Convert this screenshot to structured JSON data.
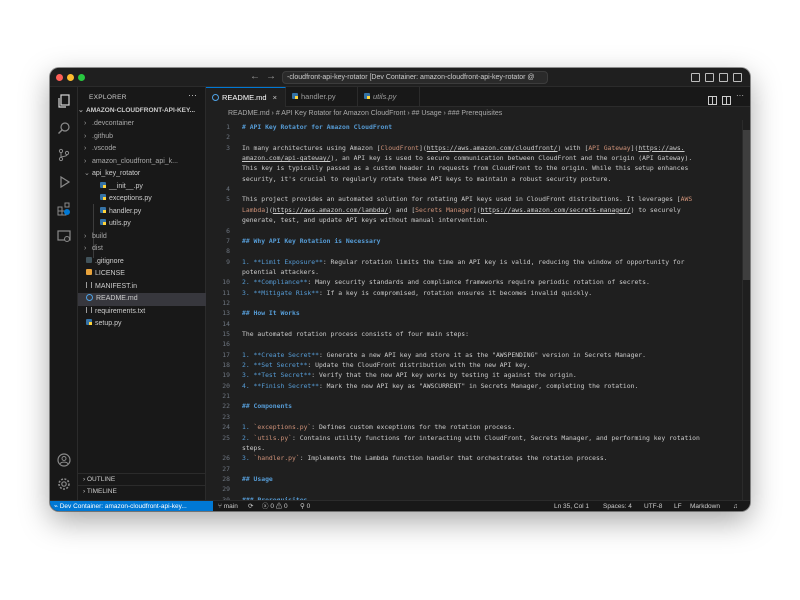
{
  "titlebar": {
    "title": "-cloudfront-api-key-rotator [Dev Container: amazon-cloudfront-api-key-rotator @"
  },
  "sidebar": {
    "header": "EXPLORER",
    "more": "···",
    "root": "AMAZON-CLOUDFRONT-API-KEY...",
    "items": [
      {
        "label": ".devcontainer",
        "kind": "folder"
      },
      {
        "label": ".github",
        "kind": "folder"
      },
      {
        "label": ".vscode",
        "kind": "folder"
      },
      {
        "label": "amazon_cloudfront_api_k...",
        "kind": "folder"
      },
      {
        "label": "api_key_rotator",
        "kind": "folder-open"
      },
      {
        "label": "__init__.py",
        "kind": "python"
      },
      {
        "label": "exceptions.py",
        "kind": "python"
      },
      {
        "label": "handler.py",
        "kind": "python"
      },
      {
        "label": "utils.py",
        "kind": "python"
      },
      {
        "label": "build",
        "kind": "folder"
      },
      {
        "label": "dist",
        "kind": "folder"
      },
      {
        "label": ".gitignore",
        "kind": "git"
      },
      {
        "label": "LICENSE",
        "kind": "license"
      },
      {
        "label": "MANIFEST.in",
        "kind": "generic"
      },
      {
        "label": "README.md",
        "kind": "info"
      },
      {
        "label": "requirements.txt",
        "kind": "generic"
      },
      {
        "label": "setup.py",
        "kind": "python"
      }
    ],
    "outline": "OUTLINE",
    "timeline": "TIMELINE"
  },
  "tabs": [
    {
      "label": "README.md",
      "close": "×"
    },
    {
      "label": "handler.py"
    },
    {
      "label": "utils.py"
    }
  ],
  "breadcrumb": "README.md  ›  # API Key Rotator for Amazon CloudFront  ›  ## Usage  ›  ### Prerequisites",
  "editor": {
    "lines": [
      {
        "n": "1",
        "segs": [
          {
            "t": "# API Key Rotator for Amazon CloudFront",
            "c": "hdr"
          }
        ]
      },
      {
        "n": "2",
        "segs": []
      },
      {
        "n": "3",
        "segs": [
          {
            "t": "In many architectures using Amazon ["
          },
          {
            "t": "CloudFront",
            "c": "lnk"
          },
          {
            "t": "]("
          },
          {
            "t": "https://aws.amazon.com/cloudfront/",
            "c": "url"
          },
          {
            "t": ") with ["
          },
          {
            "t": "API Gateway",
            "c": "lnk"
          },
          {
            "t": "]("
          },
          {
            "t": "https://aws.",
            "c": "url"
          }
        ]
      },
      {
        "n": "",
        "segs": [
          {
            "t": "amazon.com/api-gateway/",
            "c": "url"
          },
          {
            "t": "), an API key is used to secure communication between CloudFront and the origin (API Gateway)."
          }
        ]
      },
      {
        "n": "",
        "segs": [
          {
            "t": "This key is typically passed as a custom header in requests from CloudFront to the origin. While this setup enhances"
          }
        ]
      },
      {
        "n": "",
        "segs": [
          {
            "t": "security, it's crucial to regularly rotate these API keys to maintain a robust security posture."
          }
        ]
      },
      {
        "n": "4",
        "segs": []
      },
      {
        "n": "5",
        "segs": [
          {
            "t": "This project provides an automated solution for rotating API keys used in CloudFront distributions. It leverages ["
          },
          {
            "t": "AWS",
            "c": "lnk"
          }
        ]
      },
      {
        "n": "",
        "segs": [
          {
            "t": "Lambda",
            "c": "lnk"
          },
          {
            "t": "]("
          },
          {
            "t": "https://aws.amazon.com/lambda/",
            "c": "url"
          },
          {
            "t": ") and ["
          },
          {
            "t": "Secrets Manager",
            "c": "lnk"
          },
          {
            "t": "]("
          },
          {
            "t": "https://aws.amazon.com/secrets-manager/",
            "c": "url"
          },
          {
            "t": ") to securely"
          }
        ]
      },
      {
        "n": "",
        "segs": [
          {
            "t": "generate, test, and update API keys without manual intervention."
          }
        ]
      },
      {
        "n": "6",
        "segs": []
      },
      {
        "n": "7",
        "segs": [
          {
            "t": "## Why API Key Rotation is Necessary",
            "c": "hdr"
          }
        ]
      },
      {
        "n": "8",
        "segs": []
      },
      {
        "n": "9",
        "segs": [
          {
            "t": "1. ",
            "c": "bold"
          },
          {
            "t": "**Limit Exposure**",
            "c": "bold"
          },
          {
            "t": ": Regular rotation limits the time an API key is valid, reducing the window of opportunity for"
          }
        ]
      },
      {
        "n": "",
        "segs": [
          {
            "t": "potential attackers."
          }
        ]
      },
      {
        "n": "10",
        "segs": [
          {
            "t": "2. ",
            "c": "bold"
          },
          {
            "t": "**Compliance**",
            "c": "bold"
          },
          {
            "t": ": Many security standards and compliance frameworks require periodic rotation of secrets."
          }
        ]
      },
      {
        "n": "11",
        "segs": [
          {
            "t": "3. ",
            "c": "bold"
          },
          {
            "t": "**Mitigate Risk**",
            "c": "bold"
          },
          {
            "t": ": If a key is compromised, rotation ensures it becomes invalid quickly."
          }
        ]
      },
      {
        "n": "12",
        "segs": []
      },
      {
        "n": "13",
        "segs": [
          {
            "t": "## How It Works",
            "c": "hdr"
          }
        ]
      },
      {
        "n": "14",
        "segs": []
      },
      {
        "n": "15",
        "segs": [
          {
            "t": "The automated rotation process consists of four main steps:"
          }
        ]
      },
      {
        "n": "16",
        "segs": []
      },
      {
        "n": "17",
        "segs": [
          {
            "t": "1. ",
            "c": "bold"
          },
          {
            "t": "**Create Secret**",
            "c": "bold"
          },
          {
            "t": ": Generate a new API key and store it as the \"AWSPENDING\" version in Secrets Manager."
          }
        ]
      },
      {
        "n": "18",
        "segs": [
          {
            "t": "2. ",
            "c": "bold"
          },
          {
            "t": "**Set Secret**",
            "c": "bold"
          },
          {
            "t": ": Update the CloudFront distribution with the new API key."
          }
        ]
      },
      {
        "n": "19",
        "segs": [
          {
            "t": "3. ",
            "c": "bold"
          },
          {
            "t": "**Test Secret**",
            "c": "bold"
          },
          {
            "t": ": Verify that the new API key works by testing it against the origin."
          }
        ]
      },
      {
        "n": "20",
        "segs": [
          {
            "t": "4. ",
            "c": "bold"
          },
          {
            "t": "**Finish Secret**",
            "c": "bold"
          },
          {
            "t": ": Mark the new API key as \"AWSCURRENT\" in Secrets Manager, completing the rotation."
          }
        ]
      },
      {
        "n": "21",
        "segs": []
      },
      {
        "n": "22",
        "segs": [
          {
            "t": "## Components",
            "c": "hdr"
          }
        ]
      },
      {
        "n": "23",
        "segs": []
      },
      {
        "n": "24",
        "segs": [
          {
            "t": "1. ",
            "c": "bold"
          },
          {
            "t": "`exceptions.py`",
            "c": "code"
          },
          {
            "t": ": Defines custom exceptions for the rotation process."
          }
        ]
      },
      {
        "n": "25",
        "segs": [
          {
            "t": "2. ",
            "c": "bold"
          },
          {
            "t": "`utils.py`",
            "c": "code"
          },
          {
            "t": ": Contains utility functions for interacting with CloudFront, Secrets Manager, and performing key rotation"
          }
        ]
      },
      {
        "n": "",
        "segs": [
          {
            "t": "steps."
          }
        ]
      },
      {
        "n": "26",
        "segs": [
          {
            "t": "3. ",
            "c": "bold"
          },
          {
            "t": "`handler.py`",
            "c": "code"
          },
          {
            "t": ": Implements the Lambda function handler that orchestrates the rotation process."
          }
        ]
      },
      {
        "n": "27",
        "segs": []
      },
      {
        "n": "28",
        "segs": [
          {
            "t": "## Usage",
            "c": "hdr"
          }
        ]
      },
      {
        "n": "29",
        "segs": []
      },
      {
        "n": "30",
        "segs": [
          {
            "t": "### Prerequisites",
            "c": "hdr"
          }
        ]
      }
    ]
  },
  "statusbar": {
    "remote": "Dev Container: amazon-cloudfront-api-key...",
    "branch": "main",
    "problems": "0 ⚠ 0",
    "ports": "0",
    "position": "Ln 35, Col 1",
    "spaces": "Spaces: 4",
    "encoding": "UTF-8",
    "eol": "LF",
    "language": "Markdown"
  },
  "colors": {
    "accent": "#0078d4",
    "background": "#1f1f1f",
    "heading": "#569cd6",
    "link_text": "#ce9178"
  }
}
